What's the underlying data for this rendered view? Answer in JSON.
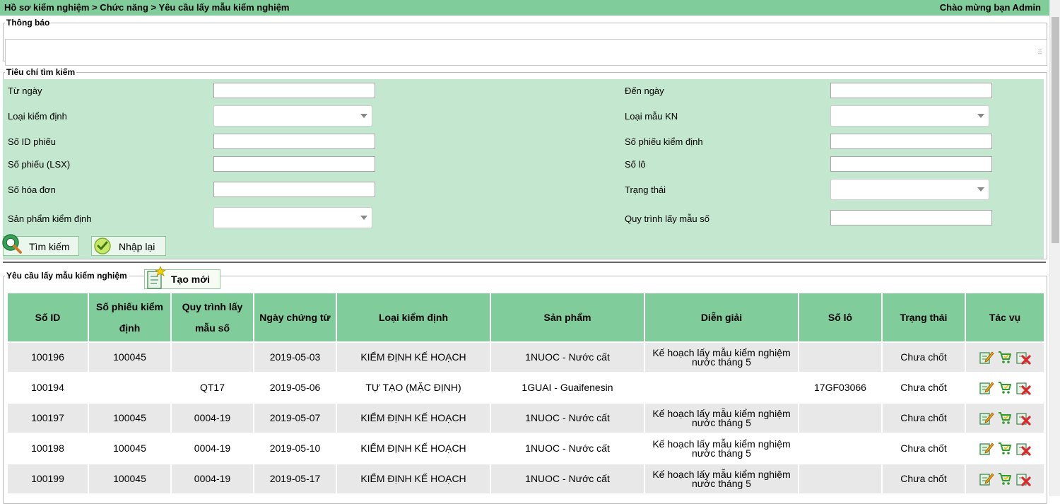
{
  "header": {
    "breadcrumb": "Hồ sơ kiểm nghiệm > Chức năng > Yêu cầu lấy mẫu kiểm nghiệm",
    "welcome": "Chào mừng bạn Admin"
  },
  "notice": {
    "legend": "Thông báo",
    "value": ""
  },
  "criteria": {
    "legend": "Tiêu chí tìm kiếm",
    "from_date": {
      "label": "Từ ngày",
      "value": ""
    },
    "to_date": {
      "label": "Đến ngày",
      "value": ""
    },
    "inspection_type": {
      "label": "Loại kiểm định",
      "value": ""
    },
    "sample_type": {
      "label": "Loại mẫu KN",
      "value": ""
    },
    "id_number": {
      "label": "Số ID phiếu",
      "value": ""
    },
    "inspection_slip": {
      "label": "Số phiếu kiểm định",
      "value": ""
    },
    "lsx_slip": {
      "label": "Số phiếu (LSX)",
      "value": ""
    },
    "batch": {
      "label": "Số lô",
      "value": ""
    },
    "invoice": {
      "label": "Số hóa đơn",
      "value": ""
    },
    "status": {
      "label": "Trạng thái",
      "value": ""
    },
    "product": {
      "label": "Sản phẩm kiểm định",
      "value": ""
    },
    "procedure": {
      "label": "Quy trình lấy mẫu số",
      "value": ""
    },
    "search_label": "Tìm kiếm",
    "reset_label": "Nhập lại"
  },
  "results": {
    "legend": "Yêu cầu lấy mẫu kiểm nghiệm",
    "new_label": "Tạo mới",
    "columns": [
      "Số ID",
      "Số phiếu kiểm định",
      "Quy trình lấy mẫu số",
      "Ngày chứng từ",
      "Loại kiểm định",
      "Sản phẩm",
      "Diễn giải",
      "Số lô",
      "Trạng thái",
      "Tác vụ"
    ],
    "rows": [
      [
        "100196",
        "100045",
        "",
        "2019-05-03",
        "KIỂM ĐỊNH KẾ HOẠCH",
        "1NUOC - Nước cất",
        "Kế hoạch lấy mẫu kiểm nghiệm nước tháng 5",
        "",
        "Chưa chốt"
      ],
      [
        "100194",
        "",
        "QT17",
        "2019-05-06",
        "TỰ TẠO (MẶC ĐỊNH)",
        "1GUAI - Guaifenesin",
        "",
        "17GF03066",
        "Chưa chốt"
      ],
      [
        "100197",
        "100045",
        "0004-19",
        "2019-05-07",
        "KIỂM ĐỊNH KẾ HOẠCH",
        "1NUOC - Nước cất",
        "Kế hoạch lấy mẫu kiểm nghiệm nước tháng 5",
        "",
        "Chưa chốt"
      ],
      [
        "100198",
        "100045",
        "0004-19",
        "2019-05-10",
        "KIỂM ĐỊNH KẾ HOẠCH",
        "1NUOC - Nước cất",
        "Kế hoạch lấy mẫu kiểm nghiệm nước tháng 5",
        "",
        "Chưa chốt"
      ],
      [
        "100199",
        "100045",
        "0004-19",
        "2019-05-17",
        "KIỂM ĐỊNH KẾ HOẠCH",
        "1NUOC - Nước cất",
        "Kế hoạch lấy mẫu kiểm nghiệm nước tháng 5",
        "",
        "Chưa chốt"
      ]
    ],
    "action_icons": [
      "edit-icon",
      "cart-icon",
      "delete-icon"
    ]
  },
  "colors": {
    "header_green": "#80cc9a",
    "panel_green": "#c4e7cf",
    "row_gray": "#e8e8e8"
  }
}
